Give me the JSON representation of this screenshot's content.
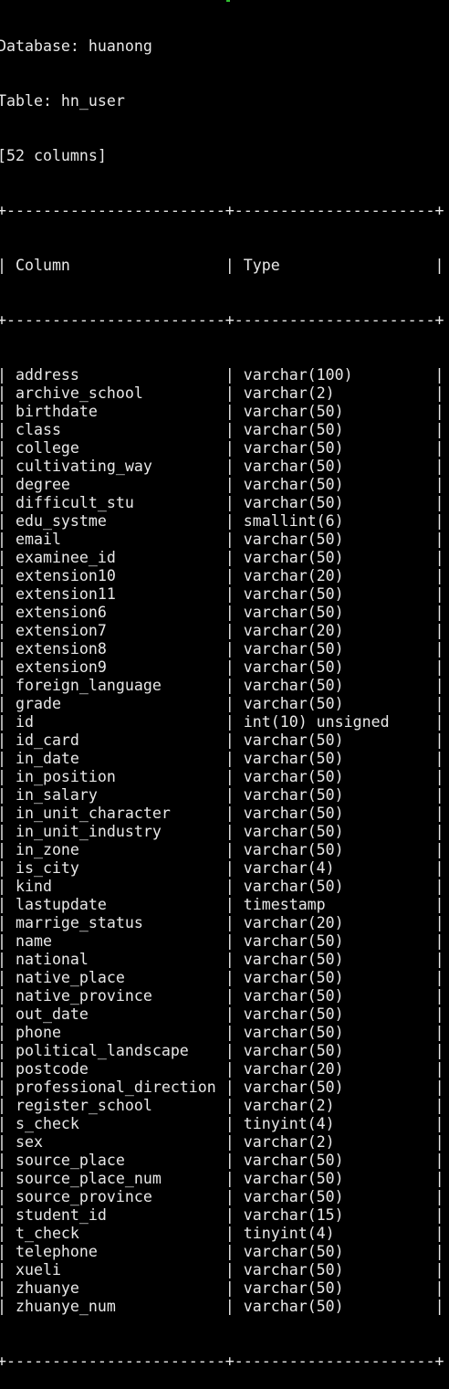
{
  "header": {
    "database_line": "Database: huanong",
    "table_line": "Table: hn_user",
    "count_line": "[52 columns]"
  },
  "table": {
    "border_line": "+------------------------+----------------------+",
    "header_line": "| Column                 | Type                 |",
    "columns": [
      "Column",
      "Type"
    ],
    "rows": [
      {
        "name": "address",
        "type": "varchar(100)"
      },
      {
        "name": "archive_school",
        "type": "varchar(2)"
      },
      {
        "name": "birthdate",
        "type": "varchar(50)"
      },
      {
        "name": "class",
        "type": "varchar(50)"
      },
      {
        "name": "college",
        "type": "varchar(50)"
      },
      {
        "name": "cultivating_way",
        "type": "varchar(50)"
      },
      {
        "name": "degree",
        "type": "varchar(50)"
      },
      {
        "name": "difficult_stu",
        "type": "varchar(50)"
      },
      {
        "name": "edu_systme",
        "type": "smallint(6)"
      },
      {
        "name": "email",
        "type": "varchar(50)"
      },
      {
        "name": "examinee_id",
        "type": "varchar(50)"
      },
      {
        "name": "extension10",
        "type": "varchar(20)"
      },
      {
        "name": "extension11",
        "type": "varchar(50)"
      },
      {
        "name": "extension6",
        "type": "varchar(50)"
      },
      {
        "name": "extension7",
        "type": "varchar(20)"
      },
      {
        "name": "extension8",
        "type": "varchar(50)"
      },
      {
        "name": "extension9",
        "type": "varchar(50)"
      },
      {
        "name": "foreign_language",
        "type": "varchar(50)"
      },
      {
        "name": "grade",
        "type": "varchar(50)"
      },
      {
        "name": "id",
        "type": "int(10) unsigned"
      },
      {
        "name": "id_card",
        "type": "varchar(50)"
      },
      {
        "name": "in_date",
        "type": "varchar(50)"
      },
      {
        "name": "in_position",
        "type": "varchar(50)"
      },
      {
        "name": "in_salary",
        "type": "varchar(50)"
      },
      {
        "name": "in_unit_character",
        "type": "varchar(50)"
      },
      {
        "name": "in_unit_industry",
        "type": "varchar(50)"
      },
      {
        "name": "in_zone",
        "type": "varchar(50)"
      },
      {
        "name": "is_city",
        "type": "varchar(4)"
      },
      {
        "name": "kind",
        "type": "varchar(50)"
      },
      {
        "name": "lastupdate",
        "type": "timestamp"
      },
      {
        "name": "marrige_status",
        "type": "varchar(20)"
      },
      {
        "name": "name",
        "type": "varchar(50)"
      },
      {
        "name": "national",
        "type": "varchar(50)"
      },
      {
        "name": "native_place",
        "type": "varchar(50)"
      },
      {
        "name": "native_province",
        "type": "varchar(50)"
      },
      {
        "name": "out_date",
        "type": "varchar(50)"
      },
      {
        "name": "phone",
        "type": "varchar(50)"
      },
      {
        "name": "political_landscape",
        "type": "varchar(50)"
      },
      {
        "name": "postcode",
        "type": "varchar(20)"
      },
      {
        "name": "professional_direction",
        "type": "varchar(50)"
      },
      {
        "name": "register_school",
        "type": "varchar(2)"
      },
      {
        "name": "s_check",
        "type": "tinyint(4)"
      },
      {
        "name": "sex",
        "type": "varchar(2)"
      },
      {
        "name": "source_place",
        "type": "varchar(50)"
      },
      {
        "name": "source_place_num",
        "type": "varchar(50)"
      },
      {
        "name": "source_province",
        "type": "varchar(50)"
      },
      {
        "name": "student_id",
        "type": "varchar(15)"
      },
      {
        "name": "t_check",
        "type": "tinyint(4)"
      },
      {
        "name": "telephone",
        "type": "varchar(50)"
      },
      {
        "name": "xueli",
        "type": "varchar(50)"
      },
      {
        "name": "zhuanye",
        "type": "varchar(50)"
      },
      {
        "name": "zhuanye_num",
        "type": "varchar(50)"
      }
    ]
  },
  "colors": {
    "background": "#000000",
    "text": "#e8e8e8",
    "cursor_accent": "#2fbf2f"
  }
}
